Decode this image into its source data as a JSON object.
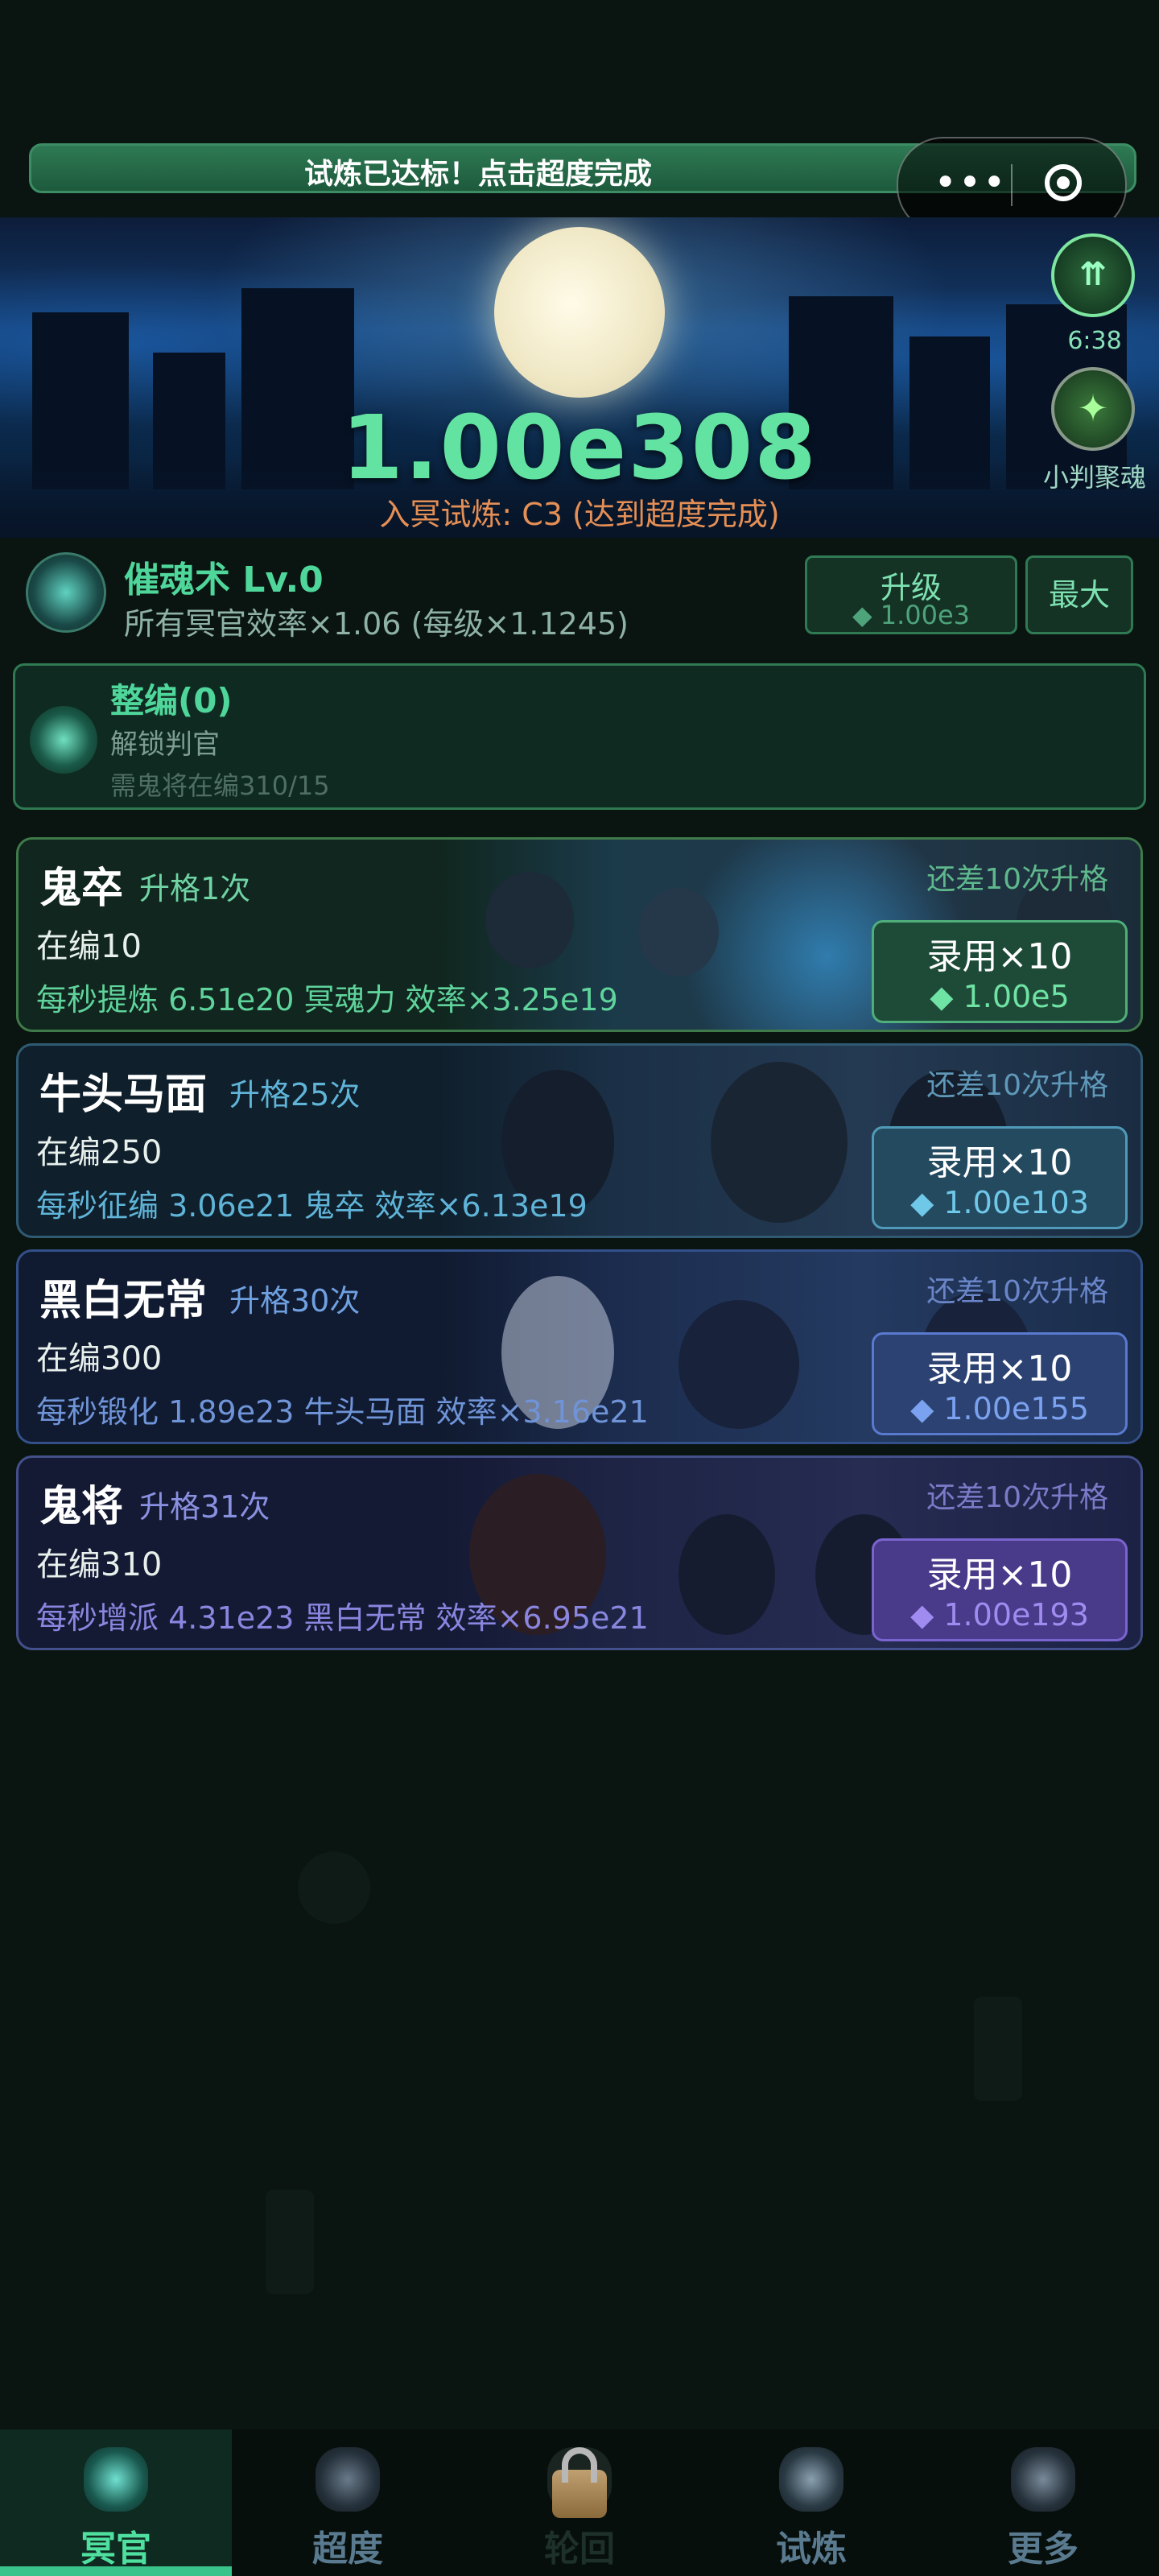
{
  "top_banner": {
    "text": "试炼已达标！点击超度完成"
  },
  "capsule": {
    "more": "•••"
  },
  "hero": {
    "value": "1.00e308",
    "subtitle": "入冥试炼: C3 (达到超度完成)",
    "timer": "6:38",
    "soul_label": "小判聚魂"
  },
  "skill": {
    "title": "催魂术 Lv.0",
    "desc": "所有冥官效率×1.06 (每级×1.1245)",
    "upgrade_label": "升级",
    "upgrade_cost": "◆ 1.00e3",
    "max_label": "最大"
  },
  "reorg": {
    "title": "整编(0)",
    "line1": "解锁判官",
    "line2": "需鬼将在编310/15"
  },
  "units": [
    {
      "name": "鬼卒",
      "rank": "升格1次",
      "count": "在编10",
      "rate": "每秒提炼 6.51e20 冥魂力  效率×3.25e19",
      "need": "还差10次升格",
      "btn_label": "录用×10",
      "btn_cost": "◆ 1.00e5"
    },
    {
      "name": "牛头马面",
      "rank": "升格25次",
      "count": "在编250",
      "rate": "每秒征编 3.06e21 鬼卒  效率×6.13e19",
      "need": "还差10次升格",
      "btn_label": "录用×10",
      "btn_cost": "◆ 1.00e103"
    },
    {
      "name": "黑白无常",
      "rank": "升格30次",
      "count": "在编300",
      "rate": "每秒锻化 1.89e23 牛头马面  效率×3.16e21",
      "need": "还差10次升格",
      "btn_label": "录用×10",
      "btn_cost": "◆ 1.00e155"
    },
    {
      "name": "鬼将",
      "rank": "升格31次",
      "count": "在编310",
      "rate": "每秒增派 4.31e23 黑白无常  效率×6.95e21",
      "need": "还差10次升格",
      "btn_label": "录用×10",
      "btn_cost": "◆ 1.00e193"
    }
  ],
  "nav": {
    "tabs": [
      {
        "label": "冥官",
        "active": true
      },
      {
        "label": "超度",
        "active": false
      },
      {
        "label": "轮回",
        "active": false,
        "locked": true
      },
      {
        "label": "试炼",
        "active": false
      },
      {
        "label": "更多",
        "active": false
      }
    ]
  },
  "colors": {
    "accent": "#38c48a",
    "hero_value": "#62e3a2",
    "subtitle": "#e58f55"
  }
}
